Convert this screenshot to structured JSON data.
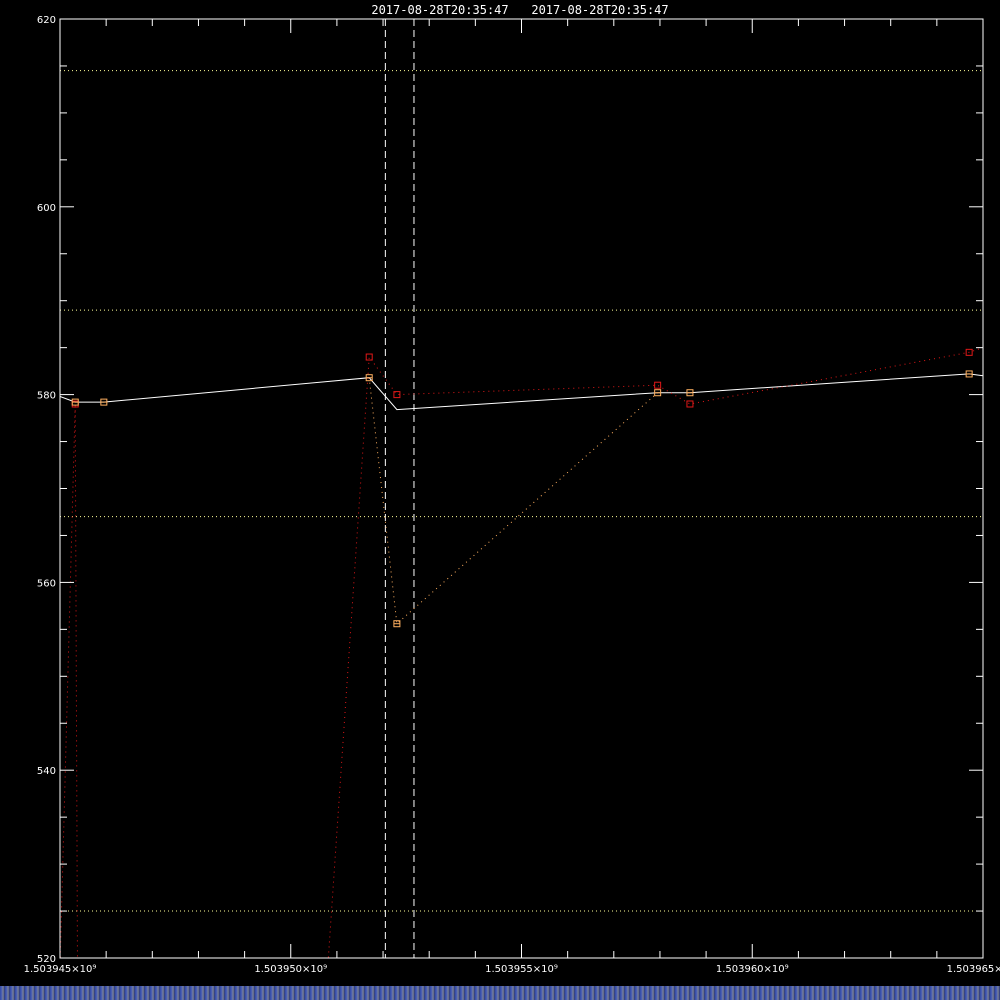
{
  "header": {
    "title_left": "2017-08-28T20:35:47",
    "title_right": "2017-08-28T20:35:47"
  },
  "colors": {
    "background": "#000000",
    "axes": "#ffffff",
    "main_line": "#ffffff",
    "red_series": "#e01818",
    "orange_series": "#ffb060",
    "reference_lines": "#ffff99"
  },
  "chart_data": {
    "type": "line",
    "xlim": [
      1503945000,
      1503965000
    ],
    "ylim": [
      520,
      620
    ],
    "x_ticks": [
      {
        "value": 1503945000,
        "label": "1.503945×10⁹"
      },
      {
        "value": 1503950000,
        "label": "1.503950×10⁹"
      },
      {
        "value": 1503955000,
        "label": "1.503955×10⁹"
      },
      {
        "value": 1503960000,
        "label": "1.503960×10⁹"
      },
      {
        "value": 1503965000,
        "label": "1.503965×10⁹"
      }
    ],
    "y_ticks": [
      {
        "value": 520,
        "label": "520"
      },
      {
        "value": 540,
        "label": "540"
      },
      {
        "value": 560,
        "label": "560"
      },
      {
        "value": 580,
        "label": "580"
      },
      {
        "value": 600,
        "label": "600"
      },
      {
        "value": 620,
        "label": "620"
      }
    ],
    "reference_levels": [
      614.5,
      589,
      567,
      525
    ],
    "vertical_markers": [
      1503952050,
      1503952670
    ],
    "series": [
      {
        "style": "solid",
        "values": [
          [
            1503945000,
            579.8
          ],
          [
            1503945330,
            579.2
          ],
          [
            1503945950,
            579.2
          ],
          [
            1503951700,
            581.8
          ],
          [
            1503952300,
            578.4
          ],
          [
            1503957950,
            580.2
          ],
          [
            1503958650,
            580.2
          ],
          [
            1503964700,
            582.2
          ],
          [
            1503965000,
            582.0
          ]
        ]
      },
      {
        "style": "red-dotted",
        "values": [
          [
            1503945000,
            519.0
          ],
          [
            1503945330,
            579.0
          ],
          [
            1503945380,
            519.0
          ]
        ]
      },
      {
        "style": "red-dotted",
        "values": [
          [
            1503950800,
            519.0
          ],
          [
            1503951700,
            584.0
          ],
          [
            1503952300,
            580.0
          ],
          [
            1503957950,
            581.0
          ],
          [
            1503958650,
            579.0
          ],
          [
            1503964700,
            584.5
          ],
          [
            1503965000,
            585.0
          ]
        ]
      },
      {
        "style": "orange-dotted",
        "values": [
          [
            1503951700,
            581.8
          ],
          [
            1503952300,
            555.6
          ],
          [
            1503957950,
            580.2
          ]
        ]
      }
    ],
    "markers_red": [
      [
        1503945330,
        579.0
      ],
      [
        1503951700,
        584.0
      ],
      [
        1503952300,
        580.0
      ],
      [
        1503957950,
        581.0
      ],
      [
        1503958650,
        579.0
      ],
      [
        1503964700,
        584.5
      ]
    ],
    "markers_orange": [
      [
        1503945330,
        579.2
      ],
      [
        1503945950,
        579.2
      ],
      [
        1503951700,
        581.8
      ],
      [
        1503952300,
        555.6
      ],
      [
        1503957950,
        580.2
      ],
      [
        1503958650,
        580.2
      ],
      [
        1503964700,
        582.2
      ]
    ]
  }
}
